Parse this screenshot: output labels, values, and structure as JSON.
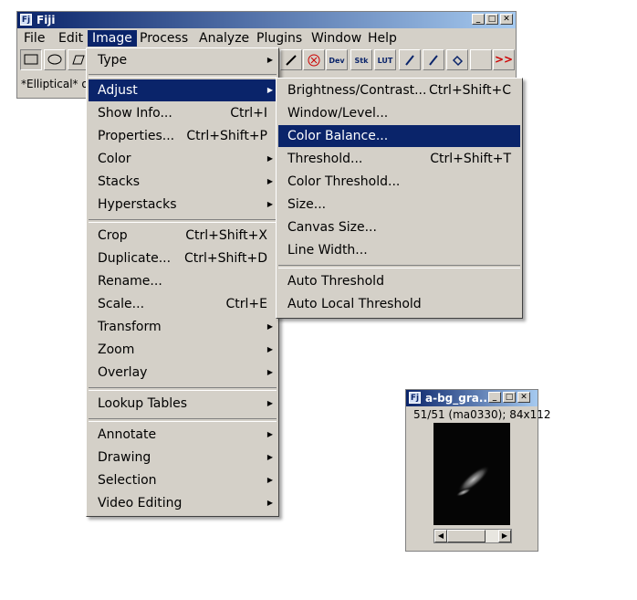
{
  "main_window": {
    "title": "Fiji",
    "icon_text": "Fiji",
    "menus": [
      "File",
      "Edit",
      "Image",
      "Process",
      "Analyze",
      "Plugins",
      "Window",
      "Help"
    ],
    "active_menu": "Image",
    "status_text": "*Elliptical* or",
    "toolbar": {
      "dev_label": "Dev",
      "stk_label": "Stk",
      "lut_label": "LUT",
      "more_label": ">>"
    }
  },
  "image_menu": {
    "items": [
      {
        "label": "Type",
        "shortcut": "",
        "submenu": true
      },
      {
        "label": "Adjust",
        "shortcut": "",
        "submenu": true,
        "highlighted": true
      },
      {
        "label": "Show Info...",
        "shortcut": "Ctrl+I"
      },
      {
        "label": "Properties...",
        "shortcut": "Ctrl+Shift+P"
      },
      {
        "label": "Color",
        "submenu": true
      },
      {
        "label": "Stacks",
        "submenu": true
      },
      {
        "label": "Hyperstacks",
        "submenu": true
      },
      {
        "label": "Crop",
        "shortcut": "Ctrl+Shift+X"
      },
      {
        "label": "Duplicate...",
        "shortcut": "Ctrl+Shift+D"
      },
      {
        "label": "Rename..."
      },
      {
        "label": "Scale...",
        "shortcut": "Ctrl+E"
      },
      {
        "label": "Transform",
        "submenu": true
      },
      {
        "label": "Zoom",
        "submenu": true
      },
      {
        "label": "Overlay",
        "submenu": true
      },
      {
        "label": "Lookup Tables",
        "submenu": true
      },
      {
        "label": "Annotate",
        "submenu": true
      },
      {
        "label": "Drawing",
        "submenu": true
      },
      {
        "label": "Selection",
        "submenu": true
      },
      {
        "label": "Video Editing",
        "submenu": true
      }
    ]
  },
  "adjust_submenu": {
    "items": [
      {
        "label": "Brightness/Contrast...",
        "shortcut": "Ctrl+Shift+C"
      },
      {
        "label": "Window/Level..."
      },
      {
        "label": "Color Balance...",
        "highlighted": true
      },
      {
        "label": "Threshold...",
        "shortcut": "Ctrl+Shift+T"
      },
      {
        "label": "Color Threshold..."
      },
      {
        "label": "Size..."
      },
      {
        "label": "Canvas Size..."
      },
      {
        "label": "Line Width..."
      },
      {
        "label": "Auto Threshold"
      },
      {
        "label": "Auto Local Threshold"
      }
    ]
  },
  "image_window": {
    "title": "a-bg_gra...",
    "info": "51/51 (ma0330); 84x112"
  },
  "colors": {
    "highlight": "#0a246a",
    "face": "#d4d0c8"
  }
}
